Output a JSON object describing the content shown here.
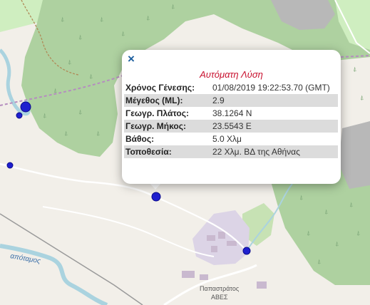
{
  "map": {
    "place_name": "Παπαστράτος",
    "place_sub": "ΑΒΕΣ",
    "river_name": "απόταμος",
    "colors": {
      "land": "#f2efe9",
      "forest": "#aed1a0",
      "woodland": "#c7e2b4",
      "grass": "#cfeec0",
      "river": "#aad3df",
      "road_track": "#b08a58",
      "rail": "#9a9a9a",
      "boundary": "#b58dbf",
      "built_area": "#dcd4e6",
      "gray_area": "#b8b8b8",
      "quake_marker": "#1f1fcf"
    }
  },
  "popup": {
    "close_icon": "close-icon",
    "close_label": "×",
    "title": "Αυτόματη Λύση",
    "rows": [
      {
        "label": "Χρόνος Γένεσης:",
        "value": "01/08/2019 19:22:53.70 (GMT)"
      },
      {
        "label": "Μέγεθος (ML):",
        "value": "2.9"
      },
      {
        "label": "Γεωγρ. Πλάτος:",
        "value": "38.1264 N"
      },
      {
        "label": "Γεωγρ. Μήκος:",
        "value": "23.5543 E"
      },
      {
        "label": "Βάθος:",
        "value": "5.0 Χλμ"
      },
      {
        "label": "Τοποθεσία:",
        "value": "22 Χλμ. ΒΔ της Αθήνας"
      }
    ]
  }
}
